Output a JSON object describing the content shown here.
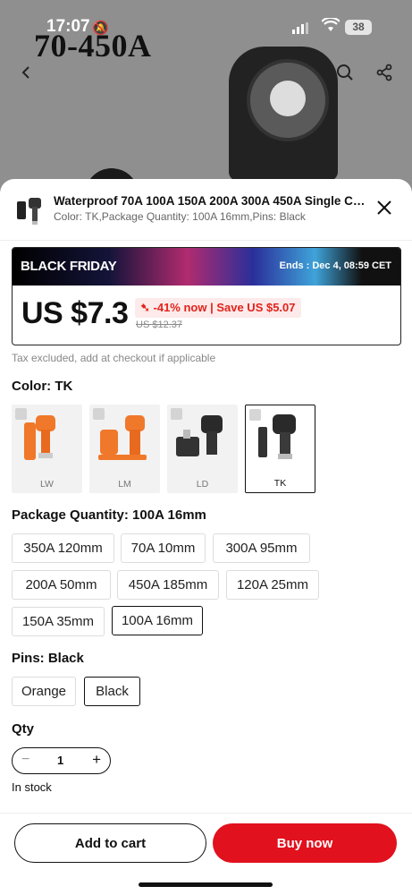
{
  "status_bar": {
    "time": "17:07",
    "battery": "38"
  },
  "background": {
    "title_text": "70-450A"
  },
  "product": {
    "title": "Waterproof 70A 100A 150A 200A 300A 450A Single Cor...",
    "subtitle": "Color: TK,Package Quantity: 100A 16mm,Pins: Black"
  },
  "promo": {
    "label": "BLACK FRIDAY",
    "ends": "Ends : Dec 4, 08:59 CET",
    "price": "US $7.3",
    "discount": "-41% now | Save US $5.07",
    "original_price": "US $12.37"
  },
  "tax_note": "Tax excluded, add at checkout if applicable",
  "color": {
    "label": "Color: TK",
    "options": [
      "LW",
      "LM",
      "LD",
      "TK"
    ],
    "selected": "TK"
  },
  "package": {
    "label": "Package Quantity: 100A 16mm",
    "options": [
      "350A 120mm",
      "70A 10mm",
      "300A 95mm",
      "200A 50mm",
      "450A 185mm",
      "120A 25mm",
      "150A 35mm",
      "100A 16mm"
    ],
    "selected": "100A 16mm"
  },
  "pins": {
    "label": "Pins: Black",
    "options": [
      "Orange",
      "Black"
    ],
    "selected": "Black"
  },
  "qty": {
    "label": "Qty",
    "value": "1"
  },
  "stock": "In stock",
  "buttons": {
    "add_to_cart": "Add to cart",
    "buy_now": "Buy now"
  },
  "colors": {
    "accent": "#e1111d",
    "discount_bg": "#fdeaea"
  }
}
